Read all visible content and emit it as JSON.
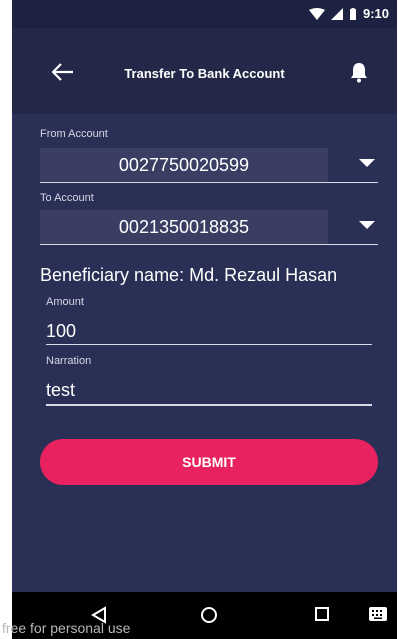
{
  "status_bar": {
    "time": "9:10",
    "icons": [
      "wifi-icon",
      "signal-icon",
      "battery-icon"
    ]
  },
  "app_bar": {
    "title": "Transfer To Bank Account",
    "back_icon": "back-arrow-icon",
    "bell_icon": "bell-icon"
  },
  "form": {
    "from_account": {
      "label": "From Account",
      "value": "0027750020599"
    },
    "to_account": {
      "label": "To Account",
      "value": "0021350018835"
    },
    "beneficiary_text": "Beneficiary name: Md. Rezaul Hasan",
    "amount": {
      "label": "Amount",
      "value": "100"
    },
    "narration": {
      "label": "Narration",
      "value": "test"
    },
    "submit_label": "SUBMIT"
  },
  "nav_bar": {
    "icons": [
      "back-triangle-icon",
      "home-circle-icon",
      "recent-square-icon",
      "keyboard-icon"
    ]
  },
  "watermark": "free for personal use",
  "colors": {
    "background": "#2a2f55",
    "appbar": "#232849",
    "field": "#3a3e63",
    "accent": "#e8225f",
    "text": "#ffffff"
  }
}
